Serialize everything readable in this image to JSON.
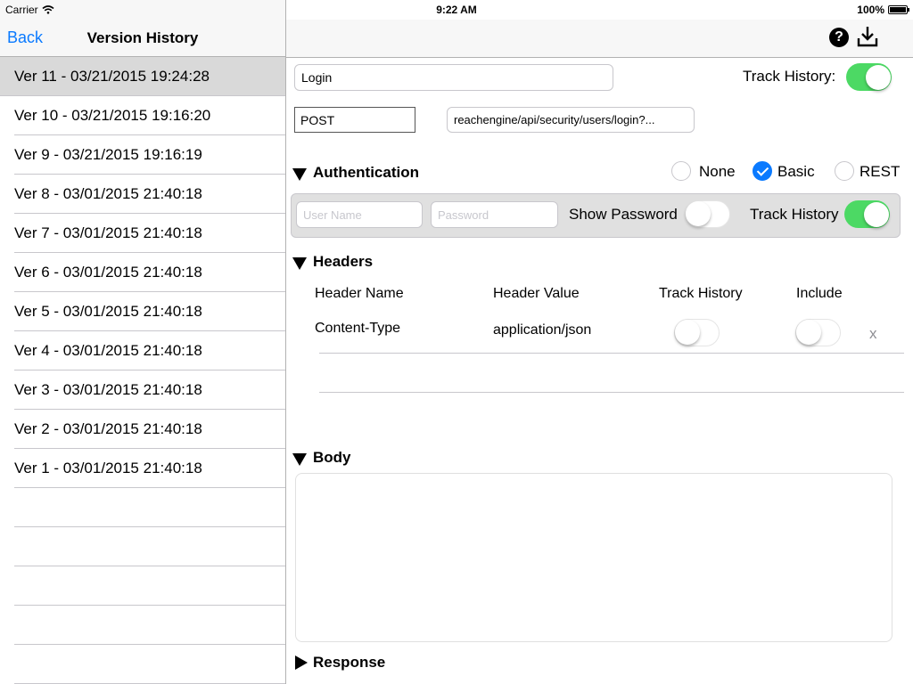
{
  "status_bar": {
    "carrier": "Carrier",
    "time": "9:22 AM",
    "battery": "100%"
  },
  "left_nav": {
    "back": "Back",
    "title": "Version History"
  },
  "versions": [
    "Ver 11 - 03/21/2015 19:24:28",
    "Ver 10 - 03/21/2015 19:16:20",
    "Ver 9 - 03/21/2015 19:16:19",
    "Ver 8 - 03/01/2015 21:40:18",
    "Ver 7 - 03/01/2015 21:40:18",
    "Ver 6 - 03/01/2015 21:40:18",
    "Ver 5 - 03/01/2015 21:40:18",
    "Ver 4 - 03/01/2015 21:40:18",
    "Ver 3 - 03/01/2015 21:40:18",
    "Ver 2 - 03/01/2015 21:40:18",
    "Ver 1 - 03/01/2015 21:40:18"
  ],
  "right_nav": {
    "help_glyph": "?",
    "help_icon": "help-icon",
    "download_icon": "download-icon"
  },
  "request": {
    "name": "Login",
    "method": "POST",
    "url": "reachengine/api/security/users/login?...",
    "track_history_label": "Track History:",
    "track_history_on": true
  },
  "authentication": {
    "section_label": "Authentication",
    "options": [
      "None",
      "Basic",
      "REST"
    ],
    "selected": "Basic",
    "username_placeholder": "User Name",
    "password_placeholder": "Password",
    "show_password_label": "Show Password",
    "show_password_on": false,
    "track_history_label": "Track History",
    "track_history_on": true
  },
  "headers": {
    "section_label": "Headers",
    "columns": [
      "Header Name",
      "Header Value",
      "Track History",
      "Include"
    ],
    "rows": [
      {
        "name": "Content-Type",
        "value": "application/json",
        "track_history": false,
        "include": false,
        "delete": "x"
      }
    ]
  },
  "body": {
    "section_label": "Body",
    "content": ""
  },
  "response": {
    "section_label": "Response"
  },
  "colors": {
    "accent": "#0a7aff",
    "toggle_on": "#4cd964",
    "selected_row": "#d9d9d9"
  }
}
